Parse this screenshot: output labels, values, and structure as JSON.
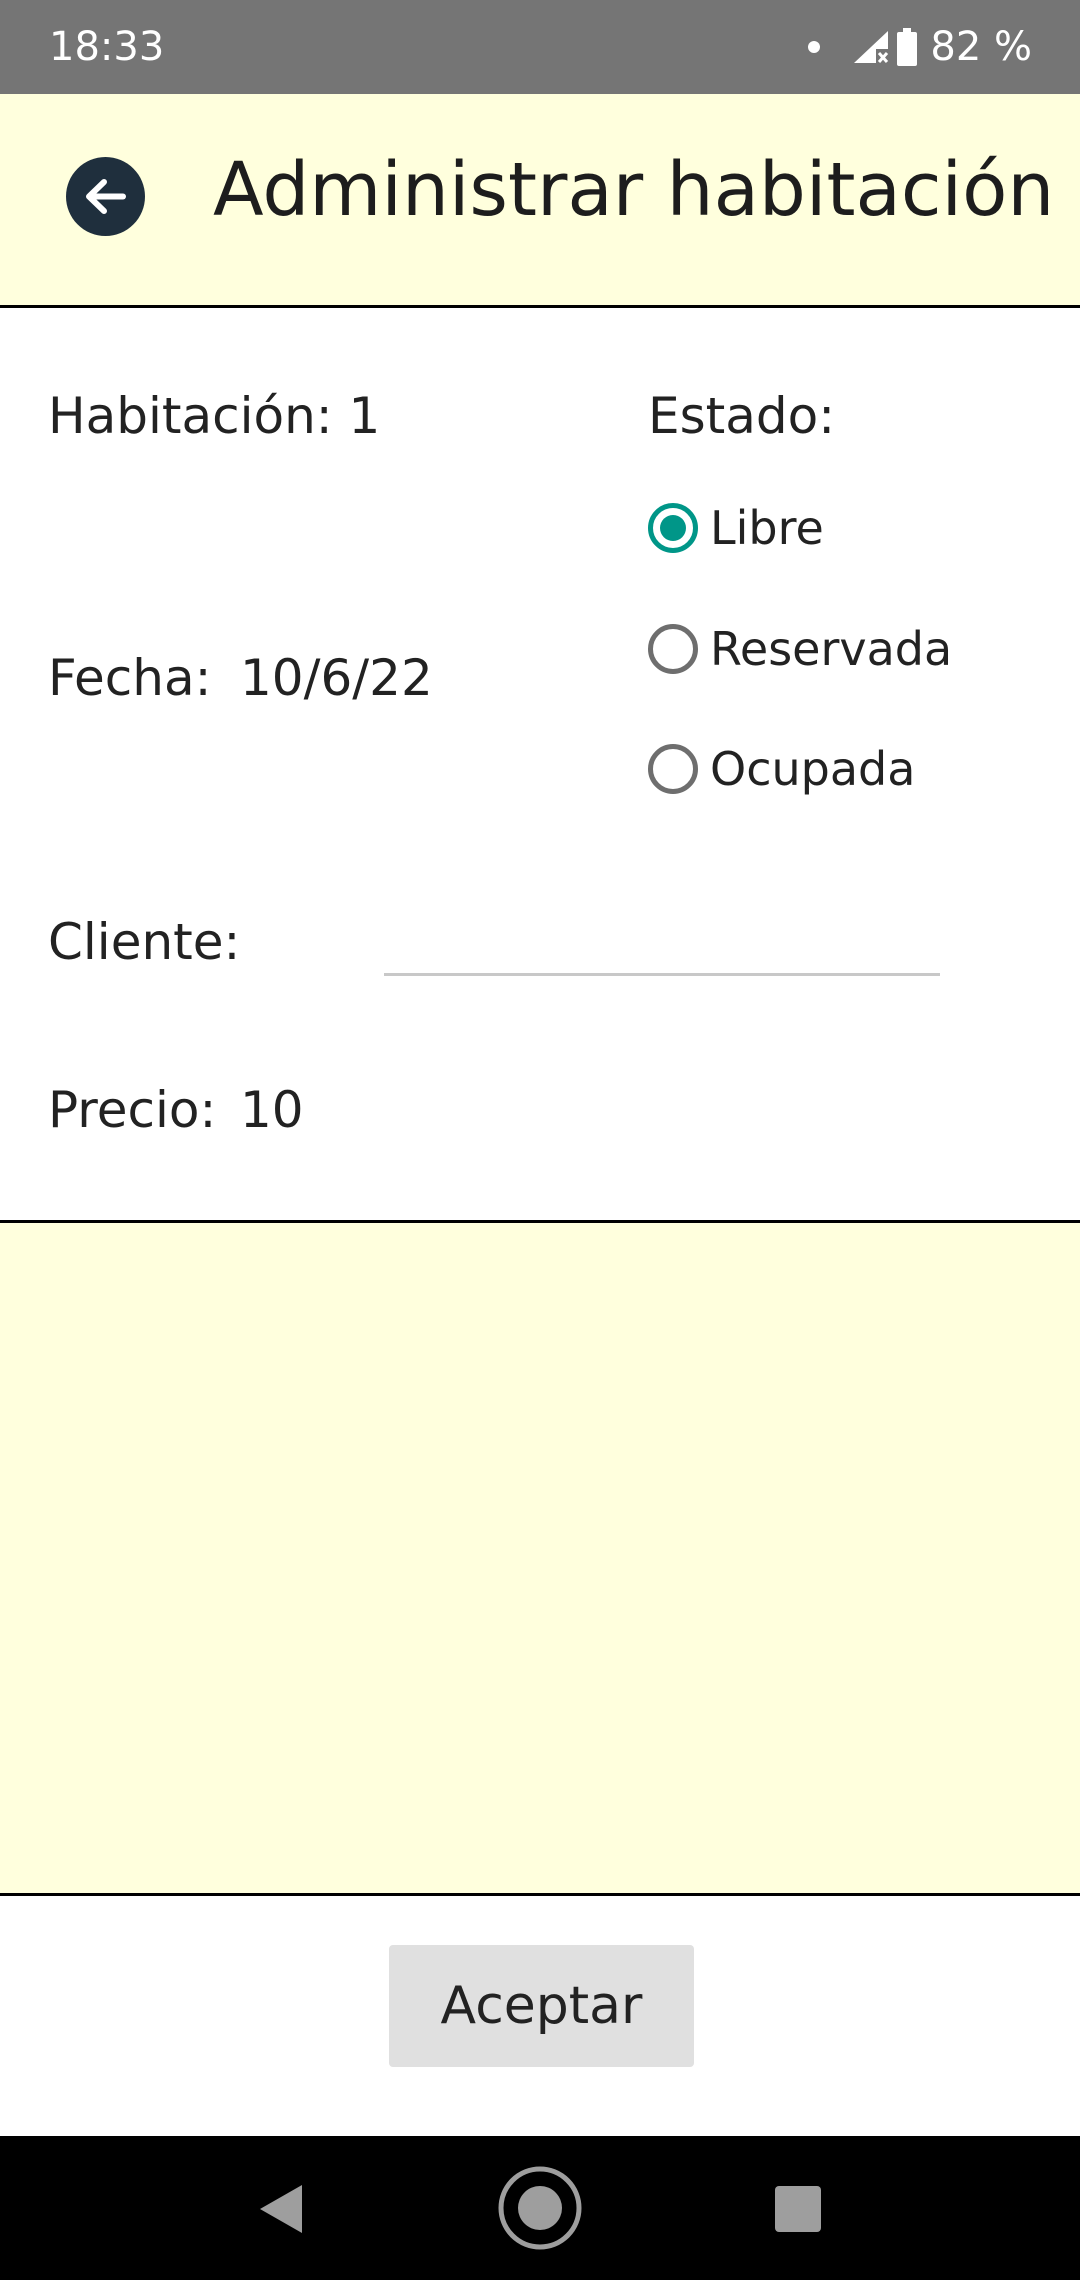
{
  "status_bar": {
    "time": "18:33",
    "battery": "82 %",
    "icons": [
      "notification-dot-icon",
      "signal-no-data-icon",
      "battery-icon"
    ]
  },
  "toolbar": {
    "back_icon": "arrow-left-icon",
    "title": "Administrar habitación"
  },
  "form": {
    "habitacion_label": "Habitación: 1",
    "estado_label": "Estado:",
    "estado_options": [
      {
        "label": "Libre",
        "selected": true
      },
      {
        "label": "Reservada",
        "selected": false
      },
      {
        "label": "Ocupada",
        "selected": false
      }
    ],
    "fecha_label": "Fecha:",
    "fecha_value": "10/6/22",
    "cliente_label": "Cliente:",
    "cliente_value": "",
    "precio_label": "Precio:",
    "precio_value": "10"
  },
  "actions": {
    "accept_label": "Aceptar"
  },
  "nav_bar": {
    "buttons": [
      "back-triangle-icon",
      "home-circle-icon",
      "recents-square-icon"
    ]
  },
  "colors": {
    "accent": "#009688",
    "panel_background": "#ffffdd",
    "status_bar": "#757575",
    "back_button": "#1f2f3d",
    "button_background": "#e0e0e0"
  }
}
